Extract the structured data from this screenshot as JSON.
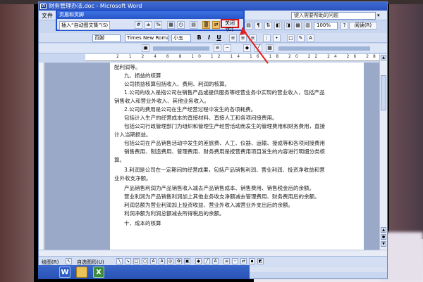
{
  "window": {
    "title": "财务管理办法.doc - Microsoft Word"
  },
  "menubar": {
    "file": "文件",
    "help_placeholder": "键入需要帮助的问题"
  },
  "hf_toolbar": {
    "title": "页眉和页脚",
    "insert_autotext": "插入“自动图文集”(S)",
    "close_label": "关闭(C)"
  },
  "standard_toolbar": {
    "zoom": "100%",
    "read_label": "阅读(R)"
  },
  "formatting": {
    "style": "页脚",
    "font": "Times New Roman",
    "size": "小五",
    "bold": "B",
    "italic": "I",
    "underline": "U"
  },
  "document": {
    "lines": [
      "配利润等。",
      "九、损益的核算",
      "公司损益核算包括收入、费用、利润的核算。",
      "1.公司的收入是指公司在销售产品或提供服务等经营业务中实现的营业收入，包括产品",
      "销售收入和营业外收入、其他业务收入。",
      "2.公司的费用是公司在生产经营过程中发生的各项耗费。",
      "包括计入生产的经营成本的直接材料、直接人工和各项间接费用。",
      "包括公司行政管理部门为组织和管理生产经营活动而发生的管理费用和财务费用，直接",
      "计入当期损益。",
      "包括公司在产品销售活动中发生的差旅费、人工、仪器、运输、接成等和各项间接费用",
      "销售费用、制造费用、管理费用、财务费用是按营费用项目发生的内容进行明细分类核",
      "算。",
      "3.利润是公司在一定期间的经营成果，包括产品销售利润、营业利润、投资净收益和营",
      "业外收支净额。",
      "产品销售利润为产品销售收入减去产品销售成本、销售费用、销售税金后的余额。",
      "营业利润为产品销售利润加上其他业务收支净额减去管理费用、财务费用后的余额。",
      "利润总额为营业利润加上投资收益、营业外收入减营业外支出后的余额。",
      "利润净额为利润总额减去所得税后的余额。",
      "十、成本的核算"
    ]
  },
  "drawing_toolbar": {
    "draw_label": "绘图(R)",
    "autoshapes_label": "自选图形(U)"
  },
  "taskbar": {
    "word_icon": "W",
    "excel_icon": "X"
  }
}
